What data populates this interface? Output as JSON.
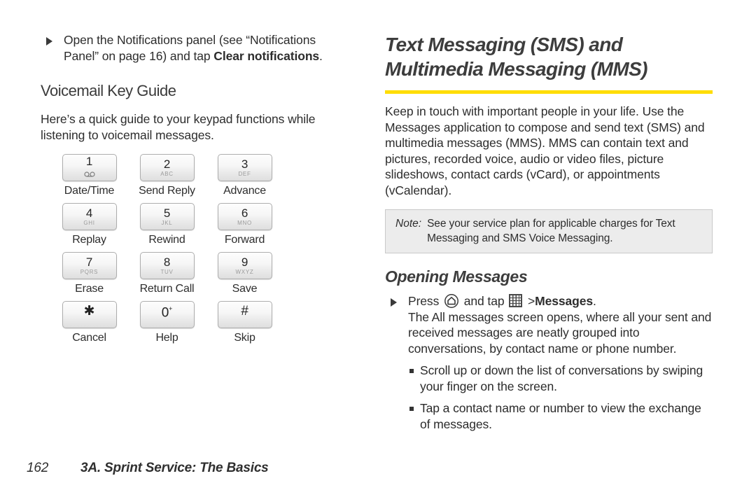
{
  "left_column": {
    "notification_bullet": {
      "text_before_bold": "Open the Notifications panel (see “Notifications Panel” on page 16) and tap ",
      "bold_text": "Clear notifications",
      "text_after_bold": "."
    },
    "heading": "Voicemail Key Guide",
    "intro": "Here’s a quick guide to your keypad functions while listening to voicemail messages.",
    "keypad": [
      {
        "number": "1",
        "letters": "",
        "icon": "voicemail-icon",
        "label": "Date/Time"
      },
      {
        "number": "2",
        "letters": "ABC",
        "icon": "",
        "label": "Send Reply"
      },
      {
        "number": "3",
        "letters": "DEF",
        "icon": "",
        "label": "Advance"
      },
      {
        "number": "4",
        "letters": "GHI",
        "icon": "",
        "label": "Replay"
      },
      {
        "number": "5",
        "letters": "JKL",
        "icon": "",
        "label": "Rewind"
      },
      {
        "number": "6",
        "letters": "MNO",
        "icon": "",
        "label": "Forward"
      },
      {
        "number": "7",
        "letters": "PQRS",
        "icon": "",
        "label": "Erase"
      },
      {
        "number": "8",
        "letters": "TUV",
        "icon": "",
        "label": "Return Call"
      },
      {
        "number": "9",
        "letters": "WXYZ",
        "icon": "",
        "label": "Save"
      },
      {
        "number": "★",
        "letters": "",
        "icon": "",
        "label": "Cancel"
      },
      {
        "number": "0",
        "letters": "",
        "icon": "",
        "label": "Help",
        "superscript": "+"
      },
      {
        "number": "#",
        "letters": "",
        "icon": "",
        "label": "Skip"
      }
    ]
  },
  "right_column": {
    "title_line_1": "Text Messaging (SMS) and",
    "title_line_2": "Multimedia Messaging (MMS)",
    "rule_color": "#ffdd00",
    "intro": "Keep in touch with important people in your life. Use the Messages application to compose and send text (SMS) and multimedia messages (MMS). MMS can contain text and pictures, recorded voice, audio or video files, picture slideshows, contact cards (vCard), or appointments (vCalendar).",
    "note": {
      "label": "Note:",
      "text": "See your service plan for applicable charges for Text Messaging and SMS Voice Messaging."
    },
    "section_heading": "Opening Messages",
    "press_step": {
      "word_press": "Press",
      "word_and_tap": "and tap",
      "separator": ">",
      "bold_target": "Messages",
      "period": "."
    },
    "press_detail": "The All messages screen opens, where all your sent and received messages are neatly grouped into conversations, by contact name or phone number.",
    "sub_bullets": [
      "Scroll up or down the list of conversations by swiping your finger on the screen.",
      "Tap a contact name or number to view the exchange of messages."
    ]
  },
  "footer": {
    "page_number": "162",
    "chapter_title": "3A. Sprint Service: The Basics"
  }
}
